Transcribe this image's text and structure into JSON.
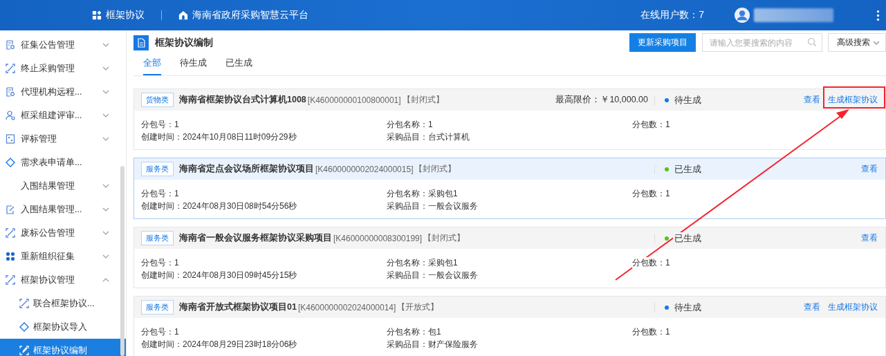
{
  "header": {
    "app_title": "框架协议",
    "platform": "海南省政府采购智慧云平台",
    "online_users": "在线用户数：7"
  },
  "sidebar": {
    "items": [
      {
        "label": "征集公告管理",
        "kind": "group",
        "expanded": false,
        "selected": false
      },
      {
        "label": "终止采购管理",
        "kind": "group",
        "expanded": false,
        "selected": false
      },
      {
        "label": "代理机构远程...",
        "kind": "group",
        "expanded": false,
        "selected": false
      },
      {
        "label": "框采组建评审...",
        "kind": "group",
        "expanded": false,
        "selected": false
      },
      {
        "label": "评标管理",
        "kind": "group",
        "expanded": false,
        "selected": false
      },
      {
        "label": "需求表申请单...",
        "kind": "link",
        "selected": false
      },
      {
        "label": "入围结果管理",
        "kind": "group",
        "expanded": false,
        "selected": false
      },
      {
        "label": "入围结果管理...",
        "kind": "group",
        "expanded": false,
        "selected": false
      },
      {
        "label": "废标公告管理",
        "kind": "group",
        "expanded": false,
        "selected": false
      },
      {
        "label": "重新组织征集",
        "kind": "group",
        "expanded": false,
        "selected": false
      },
      {
        "label": "框架协议管理",
        "kind": "group",
        "expanded": true,
        "selected": false,
        "children": [
          {
            "label": "联合框架协议...",
            "kind": "link",
            "selected": false
          },
          {
            "label": "框架协议导入",
            "kind": "link",
            "selected": false
          },
          {
            "label": "框架协议编制",
            "kind": "link",
            "selected": true
          }
        ]
      }
    ]
  },
  "page": {
    "title": "框架协议编制",
    "update_button": "更新采购项目",
    "search": {
      "placeholder": "请输入您要搜索的内容"
    },
    "advanced_search": "高级搜索",
    "tabs": [
      {
        "label": "全部",
        "selected": true
      },
      {
        "label": "待生成",
        "selected": false
      },
      {
        "label": "已生成",
        "selected": false
      }
    ]
  },
  "cards": [
    {
      "category": "货物类",
      "title": "海南省框架协议台式计算机1008",
      "code": "[K460000000100800001]",
      "mode": "【封闭式】",
      "price": "最高限价：￥10,000.00",
      "status": "待生成",
      "color": "#1677e6",
      "highlighted": false,
      "actions": [
        "查看",
        "生成框架协议"
      ],
      "details": [
        "分包号：1",
        "分包名称：1",
        "分包数：1",
        "创建时间：2024年10月08日11时09分29秒",
        "采购品目：台式计算机"
      ]
    },
    {
      "category": "服务类",
      "title": "海南省定点会议场所框架协议项目",
      "code": "[K4600000002024000015]",
      "mode": "【封闭式】",
      "status": "已生成",
      "color": "#52c41a",
      "highlighted": true,
      "actions": [
        "查看"
      ],
      "details": [
        "分包号：1",
        "分包名称：采购包1",
        "分包数：1",
        "创建时间：2024年08月30日08时54分56秒",
        "采购品目：一般会议服务"
      ]
    },
    {
      "category": "服务类",
      "title": "海南省一般会议服务框架协议采购项目",
      "code": "[K46000000008300199]",
      "mode": "【封闭式】",
      "status": "已生成",
      "color": "#52c41a",
      "highlighted": false,
      "actions": [
        "查看"
      ],
      "details": [
        "分包号：1",
        "分包名称：采购包1",
        "分包数：1",
        "创建时间：2024年08月30日09时45分15秒",
        "采购品目：一般会议服务"
      ]
    },
    {
      "category": "服务类",
      "title": "海南省开放式框架协议项目01",
      "code": "[K4600000002024000014]",
      "mode": "【开放式】",
      "status": "待生成",
      "color": "#1677e6",
      "highlighted": false,
      "actions": [
        "查看",
        "生成框架协议"
      ],
      "details": [
        "分包号：1",
        "分包名称：包1",
        "分包数：1",
        "创建时间：2024年08月29日23时18分06秒",
        "采购品目：财产保险服务"
      ]
    }
  ]
}
